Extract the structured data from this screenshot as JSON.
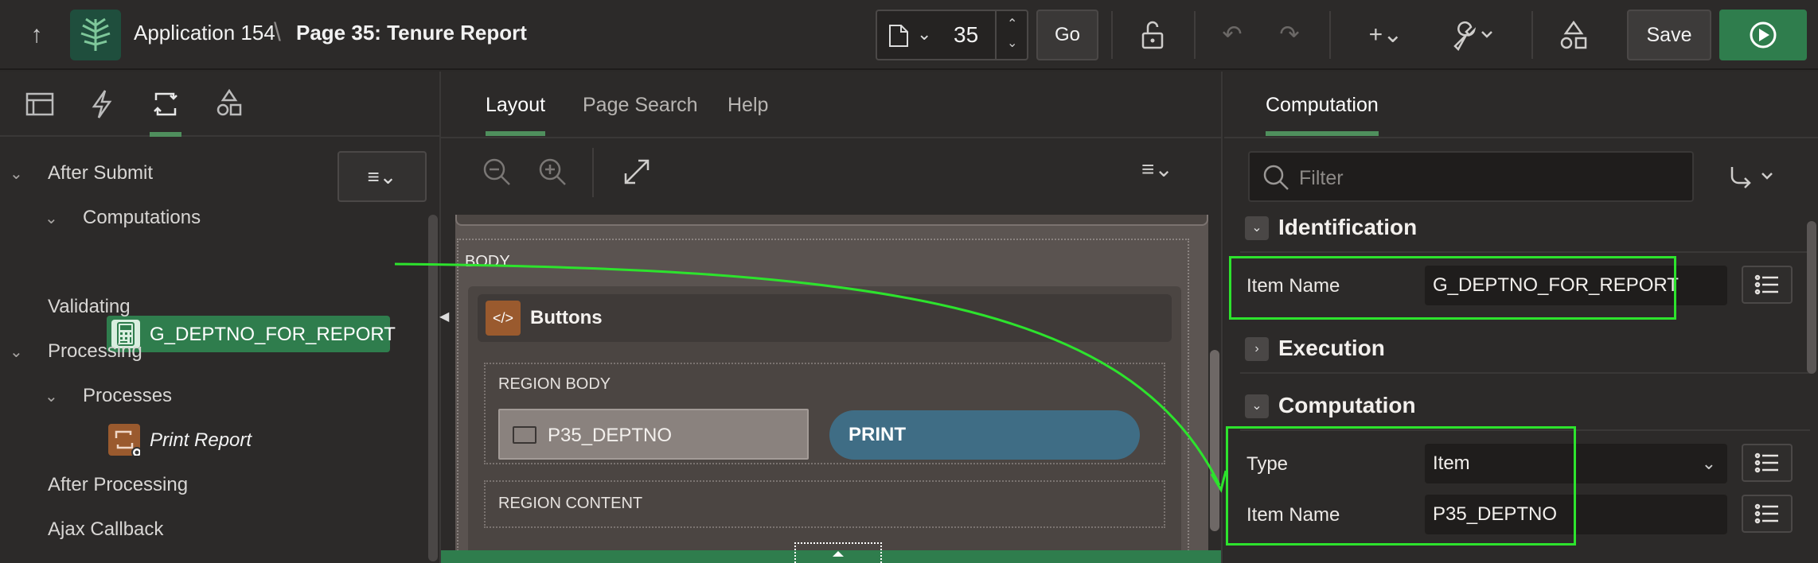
{
  "header": {
    "app_name": "Application 154",
    "separator": "\\",
    "page_name": "Page 35: Tenure Report",
    "page_number": "35",
    "go_label": "Go",
    "save_label": "Save"
  },
  "left_panel": {
    "tree": {
      "after_submit": "After Submit",
      "computations": "Computations",
      "selected_computation": "G_DEPTNO_FOR_REPORT",
      "validating": "Validating",
      "processing": "Processing",
      "processes": "Processes",
      "print_report": "Print Report",
      "after_processing": "After Processing",
      "ajax_callback": "Ajax Callback"
    }
  },
  "middle_panel": {
    "tabs": [
      "Layout",
      "Page Search",
      "Help"
    ],
    "active_tab": "Layout",
    "body_label": "BODY",
    "buttons_region": "Buttons",
    "region_body_label": "REGION BODY",
    "item_label": "P35_DEPTNO",
    "print_button": "PRINT",
    "region_content_label": "REGION CONTENT"
  },
  "right_panel": {
    "tab": "Computation",
    "filter_placeholder": "Filter",
    "sections": {
      "identification": "Identification",
      "execution": "Execution",
      "computation": "Computation"
    },
    "properties": {
      "item_name_label": "Item Name",
      "item_name_value": "G_DEPTNO_FOR_REPORT",
      "type_label": "Type",
      "type_value": "Item",
      "comp_item_name_label": "Item Name",
      "comp_item_name_value": "P35_DEPTNO"
    }
  },
  "colors": {
    "accent_green": "#2f7d4d",
    "highlight": "#2de32d",
    "print_button": "#3f6d85",
    "region_icon": "#9a5a2e"
  }
}
